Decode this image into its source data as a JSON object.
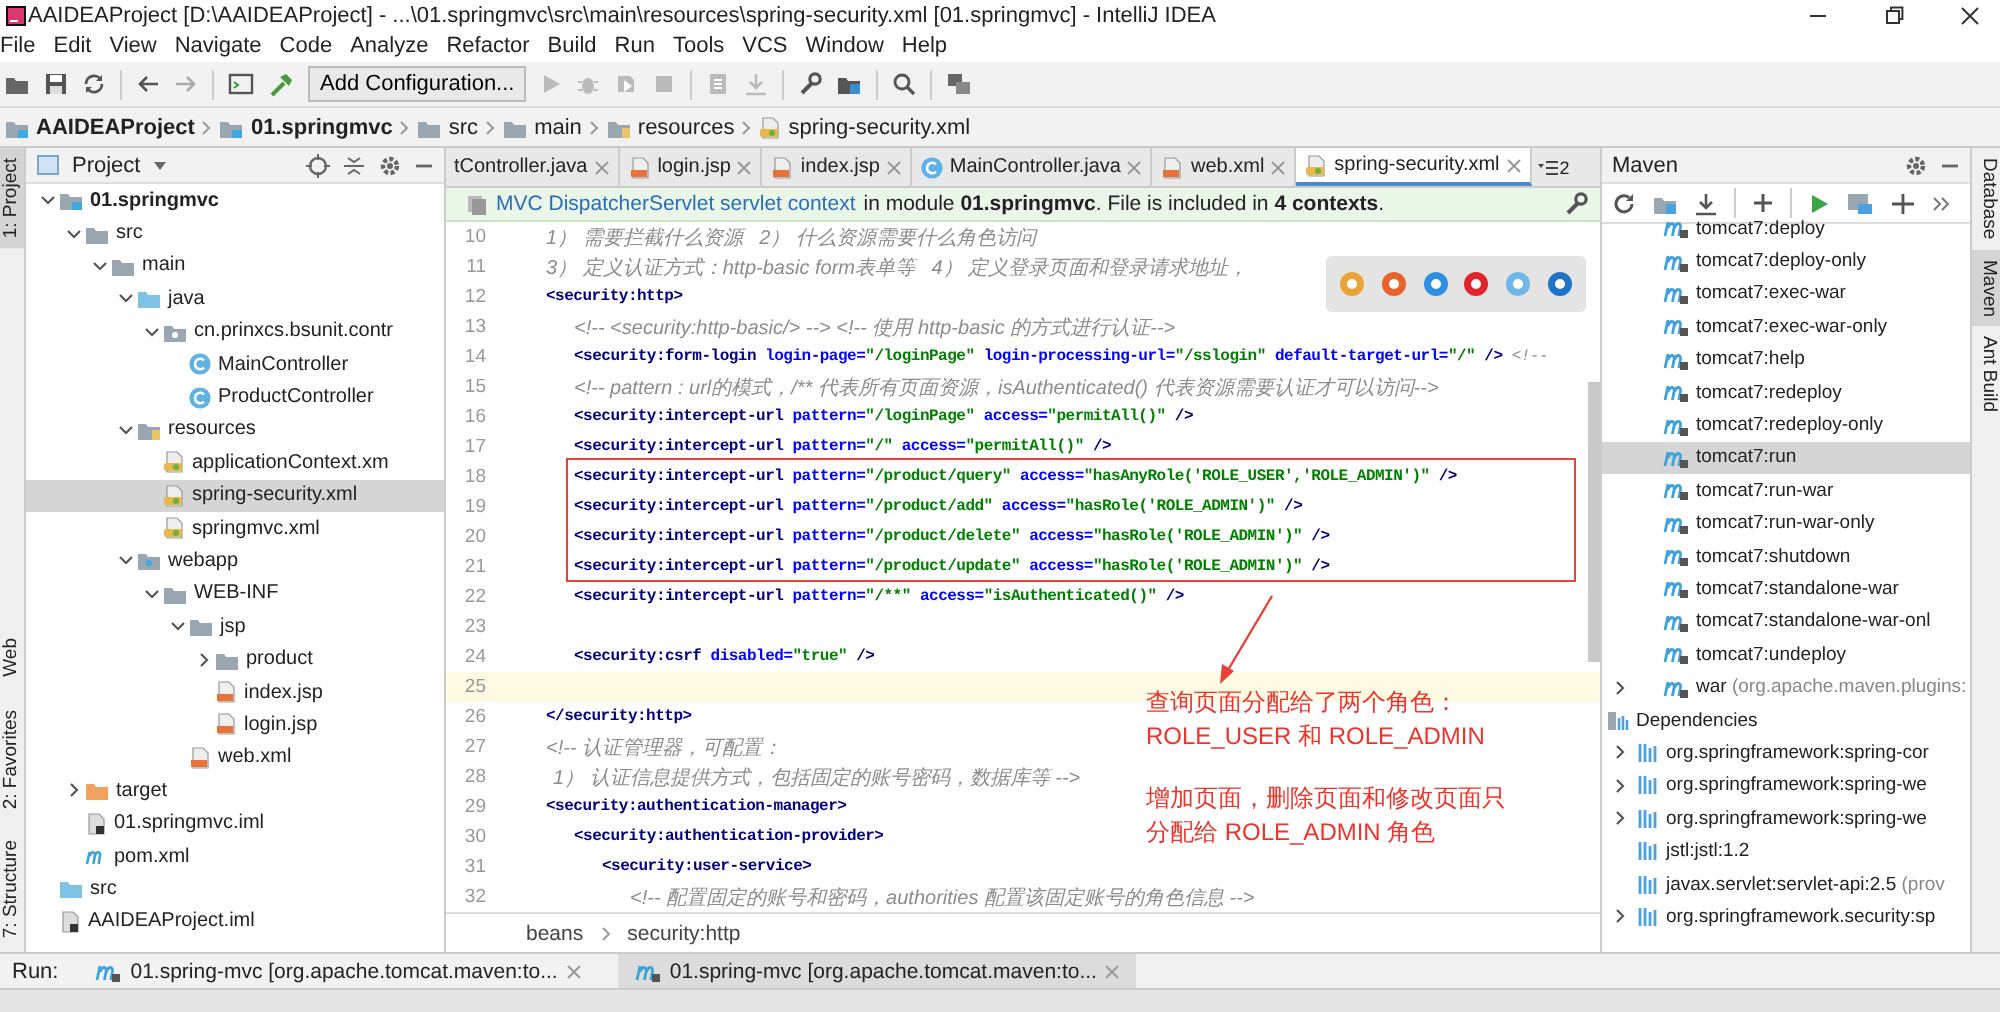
{
  "window": {
    "title": "AAIDEAProject [D:\\AAIDEAProject] - ...\\01.springmvc\\src\\main\\resources\\spring-security.xml [01.springmvc] - IntelliJ IDEA"
  },
  "menu": [
    "File",
    "Edit",
    "View",
    "Navigate",
    "Code",
    "Analyze",
    "Refactor",
    "Build",
    "Run",
    "Tools",
    "VCS",
    "Window",
    "Help"
  ],
  "toolbar": {
    "config_button": "Add Configuration..."
  },
  "navigation": [
    {
      "label": "AAIDEAProject",
      "kind": "project"
    },
    {
      "label": "01.springmvc",
      "kind": "module"
    },
    {
      "label": "src",
      "kind": "folder"
    },
    {
      "label": "main",
      "kind": "folder"
    },
    {
      "label": "resources",
      "kind": "resources"
    },
    {
      "label": "spring-security.xml",
      "kind": "config"
    }
  ],
  "left_tool_tabs": [
    {
      "label": "1: Project",
      "selected": true
    },
    {
      "label": "Web",
      "selected": false
    },
    {
      "label": "2: Favorites",
      "selected": false
    },
    {
      "label": "7: Structure",
      "selected": false
    }
  ],
  "right_tool_tabs": [
    {
      "label": "Database",
      "selected": false
    },
    {
      "label": "Maven",
      "selected": true
    },
    {
      "label": "Ant Build",
      "selected": false
    }
  ],
  "project": {
    "title": "Project",
    "tree": [
      {
        "label": "01.springmvc",
        "kind": "module",
        "expanded": true,
        "selected": false,
        "children": [
          {
            "label": "src",
            "kind": "folder",
            "expanded": true,
            "selected": false,
            "children": [
              {
                "label": "main",
                "kind": "folder",
                "expanded": true,
                "selected": false,
                "children": [
                  {
                    "label": "java",
                    "kind": "source",
                    "expanded": true,
                    "selected": false,
                    "children": [
                      {
                        "label": "cn.prinxcs.bsunit.contr",
                        "kind": "package",
                        "expanded": true,
                        "selected": false,
                        "children": [
                          {
                            "label": "MainController",
                            "kind": "class",
                            "selected": false
                          },
                          {
                            "label": "ProductController",
                            "kind": "class",
                            "selected": false
                          }
                        ]
                      }
                    ]
                  },
                  {
                    "label": "resources",
                    "kind": "resources",
                    "expanded": true,
                    "selected": false,
                    "children": [
                      {
                        "label": "applicationContext.xm",
                        "kind": "config",
                        "selected": false
                      },
                      {
                        "label": "spring-security.xml",
                        "kind": "config",
                        "selected": true
                      },
                      {
                        "label": "springmvc.xml",
                        "kind": "config",
                        "selected": false
                      }
                    ]
                  },
                  {
                    "label": "webapp",
                    "kind": "web",
                    "expanded": true,
                    "selected": false,
                    "children": [
                      {
                        "label": "WEB-INF",
                        "kind": "folder",
                        "expanded": true,
                        "selected": false,
                        "children": [
                          {
                            "label": "jsp",
                            "kind": "folder",
                            "expanded": true,
                            "selected": false,
                            "children": [
                              {
                                "label": "product",
                                "kind": "folder",
                                "expanded": false,
                                "selected": false
                              },
                              {
                                "label": "index.jsp",
                                "kind": "jsp",
                                "selected": false
                              },
                              {
                                "label": "login.jsp",
                                "kind": "jsp",
                                "selected": false
                              }
                            ]
                          },
                          {
                            "label": "web.xml",
                            "kind": "xml",
                            "selected": false
                          }
                        ]
                      }
                    ]
                  }
                ]
              }
            ]
          },
          {
            "label": "target",
            "kind": "excluded",
            "expanded": false,
            "selected": false
          },
          {
            "label": "01.springmvc.iml",
            "kind": "iml",
            "selected": false
          },
          {
            "label": "pom.xml",
            "kind": "pom",
            "selected": false
          }
        ]
      },
      {
        "label": "src",
        "kind": "source",
        "selected": false
      },
      {
        "label": "AAIDEAProject.iml",
        "kind": "iml",
        "selected": false
      }
    ]
  },
  "editor": {
    "tabs": [
      {
        "label": "tController.java",
        "selected": false
      },
      {
        "label": "login.jsp",
        "kind": "jsp",
        "selected": false
      },
      {
        "label": "index.jsp",
        "kind": "jsp",
        "selected": false
      },
      {
        "label": "MainController.java",
        "kind": "class",
        "selected": false
      },
      {
        "label": "web.xml",
        "kind": "xml",
        "selected": false
      },
      {
        "label": "spring-security.xml",
        "kind": "config",
        "selected": true
      }
    ],
    "tab_overflow": "2",
    "banner": {
      "link": "MVC DispatcherServlet servlet context",
      "text": "in module **01.springmvc**. File is included in **4 contexts**."
    },
    "lines": [
      {
        "number": "10",
        "kind": "comment",
        "text": "    1） 需要拦截什么资源   2） 什么资源需要什么角色访问",
        "current": false
      },
      {
        "number": "11",
        "kind": "comment",
        "text": "    3） 定义认证方式：http-basic form表单等   4） 定义登录页面和登录请求地址，",
        "current": false
      },
      {
        "number": "12",
        "kind": "code",
        "text": "    <security:http>",
        "current": false
      },
      {
        "number": "13",
        "kind": "comment",
        "text": "        <!-- <security:http-basic/> --> <!-- 使用 http-basic 的方式进行认证-->",
        "current": false
      },
      {
        "number": "14",
        "kind": "code",
        "text": "        <security:form-login login-page=\"/loginPage\" login-processing-url=\"/sslogin\" default-target-url=\"/\" /> <!--",
        "current": false
      },
      {
        "number": "15",
        "kind": "comment",
        "text": "        <!-- pattern : url的模式，/** 代表所有页面资源，isAuthenticated() 代表资源需要认证才可以访问-->",
        "current": false
      },
      {
        "number": "16",
        "kind": "code",
        "text": "        <security:intercept-url pattern=\"/loginPage\" access=\"permitAll()\" />",
        "current": false
      },
      {
        "number": "17",
        "kind": "code",
        "text": "        <security:intercept-url pattern=\"/\" access=\"permitAll()\" />",
        "current": false
      },
      {
        "number": "18",
        "kind": "code",
        "text": "        <security:intercept-url pattern=\"/product/query\" access=\"hasAnyRole('ROLE_USER','ROLE_ADMIN')\" />",
        "current": false
      },
      {
        "number": "19",
        "kind": "code",
        "text": "        <security:intercept-url pattern=\"/product/add\" access=\"hasRole('ROLE_ADMIN')\" />",
        "current": false
      },
      {
        "number": "20",
        "kind": "code",
        "text": "        <security:intercept-url pattern=\"/product/delete\" access=\"hasRole('ROLE_ADMIN')\" />",
        "current": false
      },
      {
        "number": "21",
        "kind": "code",
        "text": "        <security:intercept-url pattern=\"/product/update\" access=\"hasRole('ROLE_ADMIN')\" />",
        "current": false
      },
      {
        "number": "22",
        "kind": "code",
        "text": "        <security:intercept-url pattern=\"/**\" access=\"isAuthenticated()\" />",
        "current": false
      },
      {
        "number": "23",
        "kind": "code",
        "current": false
      },
      {
        "number": "24",
        "kind": "code",
        "text": "        <security:csrf disabled=\"true\" />",
        "current": false
      },
      {
        "number": "25",
        "kind": "code",
        "current": true
      },
      {
        "number": "26",
        "kind": "code",
        "text": "    </security:http>",
        "current": false
      },
      {
        "number": "27",
        "kind": "comment",
        "text": "    <!-- 认证管理器，可配置：",
        "current": false
      },
      {
        "number": "28",
        "kind": "comment",
        "text": "     1） 认证信息提供方式，包括固定的账号密码，数据库等 -->",
        "current": false
      },
      {
        "number": "29",
        "kind": "code",
        "text": "    <security:authentication-manager>",
        "current": false
      },
      {
        "number": "30",
        "kind": "code",
        "text": "        <security:authentication-provider>",
        "current": false
      },
      {
        "number": "31",
        "kind": "code",
        "text": "            <security:user-service>",
        "current": false
      },
      {
        "number": "32",
        "kind": "comment",
        "text": "                <!-- 配置固定的账号和密码，authorities 配置该固定账号的角色信息 -->",
        "current": false
      }
    ],
    "annotation": [
      [
        "查询页面分配给了两个角色：",
        "ROLE_USER 和 ROLE_ADMIN"
      ],
      [
        "增加页面，删除页面和修改页面只",
        "分配给 ROLE_ADMIN 角色"
      ]
    ],
    "breadcrumbs": [
      "beans",
      "security:http"
    ]
  },
  "maven": {
    "title": "Maven",
    "goals": [
      {
        "label": "tomcat7:deploy",
        "selected": false
      },
      {
        "label": "tomcat7:deploy-only",
        "selected": false
      },
      {
        "label": "tomcat7:exec-war",
        "selected": false
      },
      {
        "label": "tomcat7:exec-war-only",
        "selected": false
      },
      {
        "label": "tomcat7:help",
        "selected": false
      },
      {
        "label": "tomcat7:redeploy",
        "selected": false
      },
      {
        "label": "tomcat7:redeploy-only",
        "selected": false
      },
      {
        "label": "tomcat7:run",
        "selected": true
      },
      {
        "label": "tomcat7:run-war",
        "selected": false
      },
      {
        "label": "tomcat7:run-war-only",
        "selected": false
      },
      {
        "label": "tomcat7:shutdown",
        "selected": false
      },
      {
        "label": "tomcat7:standalone-war",
        "selected": false
      },
      {
        "label": "tomcat7:standalone-war-onl",
        "selected": false
      },
      {
        "label": "tomcat7:undeploy",
        "selected": false
      }
    ],
    "plugins": [
      {
        "label": "war",
        "note": "(org.apache.maven.plugins:",
        "expanded": false
      }
    ],
    "dependencies": {
      "label": "Dependencies",
      "children": [
        {
          "label": "org.springframework:spring-cor",
          "expanded": false
        },
        {
          "label": "org.springframework:spring-we",
          "expanded": false
        },
        {
          "label": "org.springframework:spring-we",
          "expanded": false
        },
        {
          "label": "jstl:jstl:1.2"
        },
        {
          "label": "javax.servlet:servlet-api:2.5",
          "note": "(prov"
        },
        {
          "label": "org.springframework.security:sp",
          "expanded": false
        }
      ]
    }
  },
  "run": {
    "label": "Run:",
    "tabs": [
      {
        "label": "01.spring-mvc [org.apache.tomcat.maven:to...",
        "selected": false
      },
      {
        "label": "01.spring-mvc [org.apache.tomcat.maven:to...",
        "selected": true
      }
    ]
  }
}
